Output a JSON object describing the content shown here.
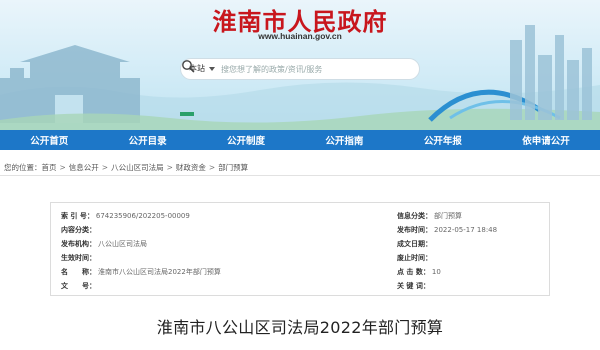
{
  "header": {
    "site_title": "淮南市人民政府",
    "site_url": "www.huainan.gov.cn",
    "search": {
      "scope": "本站",
      "placeholder": "搜您想了解的政策/资讯/服务"
    }
  },
  "nav": {
    "items": [
      {
        "label": "公开首页"
      },
      {
        "label": "公开目录"
      },
      {
        "label": "公开制度"
      },
      {
        "label": "公开指南"
      },
      {
        "label": "公开年报"
      },
      {
        "label": "依申请公开"
      }
    ]
  },
  "breadcrumb": {
    "prefix": "您的位置：",
    "items": [
      "首页",
      "信息公开",
      "八公山区司法局",
      "财政资金",
      "部门预算"
    ]
  },
  "info": {
    "left": [
      {
        "label": "索 引 号：",
        "value": "674235906/202205-00009"
      },
      {
        "label": "内容分类：",
        "value": ""
      },
      {
        "label": "发布机构：",
        "value": "八公山区司法局"
      },
      {
        "label": "生效时间：",
        "value": ""
      },
      {
        "label": "名　　称：",
        "value": "淮南市八公山区司法局2022年部门预算"
      },
      {
        "label": "文　　号：",
        "value": ""
      }
    ],
    "right": [
      {
        "label": "信息分类：",
        "value": "部门预算"
      },
      {
        "label": "发布时间：",
        "value": "2022-05-17 18:48"
      },
      {
        "label": "成文日期：",
        "value": ""
      },
      {
        "label": "废止时间：",
        "value": ""
      },
      {
        "label": "点 击 数：",
        "value": "10"
      },
      {
        "label": "关 键 词：",
        "value": ""
      }
    ]
  },
  "article": {
    "title": "淮南市八公山区司法局2022年部门预算"
  },
  "colors": {
    "title_red": "#c8161d",
    "nav_blue": "#1d77c8"
  }
}
